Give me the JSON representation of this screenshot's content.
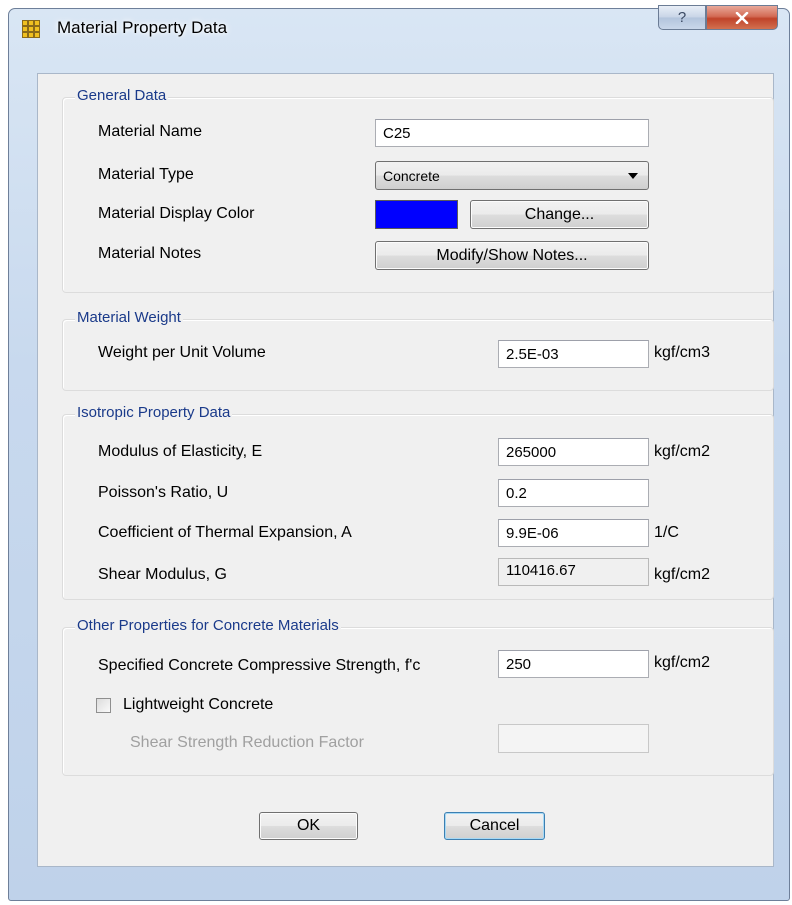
{
  "window": {
    "title": "Material Property Data",
    "help_glyph": "?",
    "close_glyph": "✕",
    "icon": "grid-app-icon"
  },
  "general": {
    "legend": "General Data",
    "material_name_label": "Material Name",
    "material_name_value": "C25",
    "material_type_label": "Material Type",
    "material_type_value": "Concrete",
    "display_color_label": "Material Display Color",
    "display_color": "#0000ff",
    "change_button": "Change...",
    "notes_label": "Material Notes",
    "notes_button": "Modify/Show Notes..."
  },
  "weight": {
    "legend": "Material Weight",
    "weight_label": "Weight per Unit Volume",
    "weight_value": "2.5E-03",
    "weight_unit": "kgf/cm3"
  },
  "isotropic": {
    "legend": "Isotropic Property Data",
    "modulus_label": "Modulus of Elasticity,  E",
    "modulus_value": "265000",
    "modulus_unit": "kgf/cm2",
    "poisson_label": "Poisson's Ratio,  U",
    "poisson_value": "0.2",
    "thermal_label": "Coefficient of Thermal Expansion,  A",
    "thermal_value": "9.9E-06",
    "thermal_unit": "1/C",
    "shear_label": "Shear Modulus,  G",
    "shear_value": "110416.67",
    "shear_unit": "kgf/cm2"
  },
  "concrete": {
    "legend": "Other Properties for Concrete Materials",
    "fc_label": "Specified Concrete Compressive Strength, f'c",
    "fc_value": "250",
    "fc_unit": "kgf/cm2",
    "lightweight_label": "Lightweight Concrete",
    "lightweight_checked": false,
    "reduction_label": "Shear Strength Reduction Factor",
    "reduction_value": ""
  },
  "buttons": {
    "ok": "OK",
    "cancel": "Cancel"
  }
}
